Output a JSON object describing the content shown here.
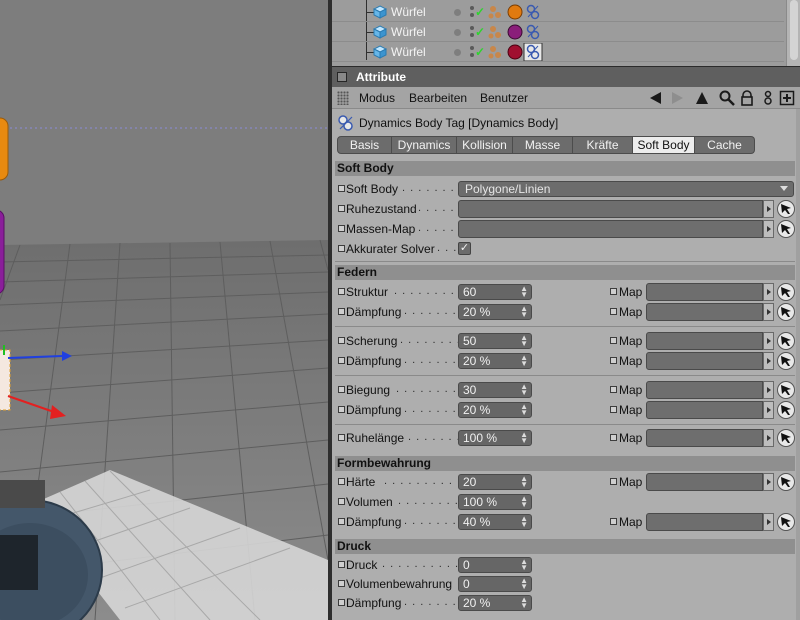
{
  "object_manager": {
    "rows": [
      {
        "name": "Würfel"
      },
      {
        "name": "Würfel"
      },
      {
        "name": "Würfel"
      }
    ]
  },
  "attributes": {
    "title": "Attribute",
    "menu": [
      "Modus",
      "Bearbeiten",
      "Benutzer"
    ],
    "tag_title": "Dynamics Body Tag [Dynamics Body]",
    "tabs": [
      {
        "label": "Basis",
        "active": false
      },
      {
        "label": "Dynamics",
        "active": false
      },
      {
        "label": "Kollision",
        "active": false
      },
      {
        "label": "Masse",
        "active": false
      },
      {
        "label": "Kräfte",
        "active": false
      },
      {
        "label": "Soft Body",
        "active": true
      },
      {
        "label": "Cache",
        "active": false
      }
    ],
    "sections": {
      "soft_body": {
        "title": "Soft Body",
        "soft_body_label": "Soft Body",
        "soft_body_value": "Polygone/Linien",
        "ruhezustand_label": "Ruhezustand",
        "massen_map_label": "Massen-Map",
        "akkurater_solver_label": "Akkurater Solver",
        "akkurater_solver_checked": true
      },
      "federn": {
        "title": "Federn",
        "struktur_label": "Struktur",
        "struktur_value": "60",
        "daempfung1_label": "Dämpfung",
        "daempfung1_value": "20 %",
        "scherung_label": "Scherung",
        "scherung_value": "50",
        "daempfung2_label": "Dämpfung",
        "daempfung2_value": "20 %",
        "biegung_label": "Biegung",
        "biegung_value": "30",
        "daempfung3_label": "Dämpfung",
        "daempfung3_value": "20 %",
        "ruhelaenge_label": "Ruhelänge",
        "ruhelaenge_value": "100 %",
        "map_label": "Map"
      },
      "formbewahrung": {
        "title": "Formbewahrung",
        "haerte_label": "Härte",
        "haerte_value": "20",
        "volumen_label": "Volumen",
        "volumen_value": "100 %",
        "daempfung_label": "Dämpfung",
        "daempfung_value": "40 %",
        "map_label": "Map"
      },
      "druck": {
        "title": "Druck",
        "druck_label": "Druck",
        "druck_value": "0",
        "volumenbewahrung_label": "Volumenbewahrung",
        "volumenbewahrung_value": "0",
        "daempfung_label": "Dämpfung",
        "daempfung_value": "20 %"
      }
    }
  },
  "colors": {
    "viewport_bg": "#7c7c7c",
    "panel_bg": "#aeaeae",
    "active_tab": "#ededed",
    "axis_x": "#e32020",
    "axis_y": "#20c020",
    "axis_z": "#2040e0",
    "object_orange": "#e88a10",
    "object_purple": "#8a1e9a",
    "check_green": "#2fd32f"
  },
  "icons": {
    "cube": "cube-icon",
    "tag_material_orange": "material-sphere-orange-icon",
    "tag_material_red": "material-sphere-red-icon",
    "tag_dynamics": "dynamics-body-tag-icon",
    "toolbar": [
      "arrow-left-icon",
      "arrow-up-icon",
      "search-icon",
      "lock-icon",
      "settings-icon",
      "new-panel-icon"
    ]
  }
}
